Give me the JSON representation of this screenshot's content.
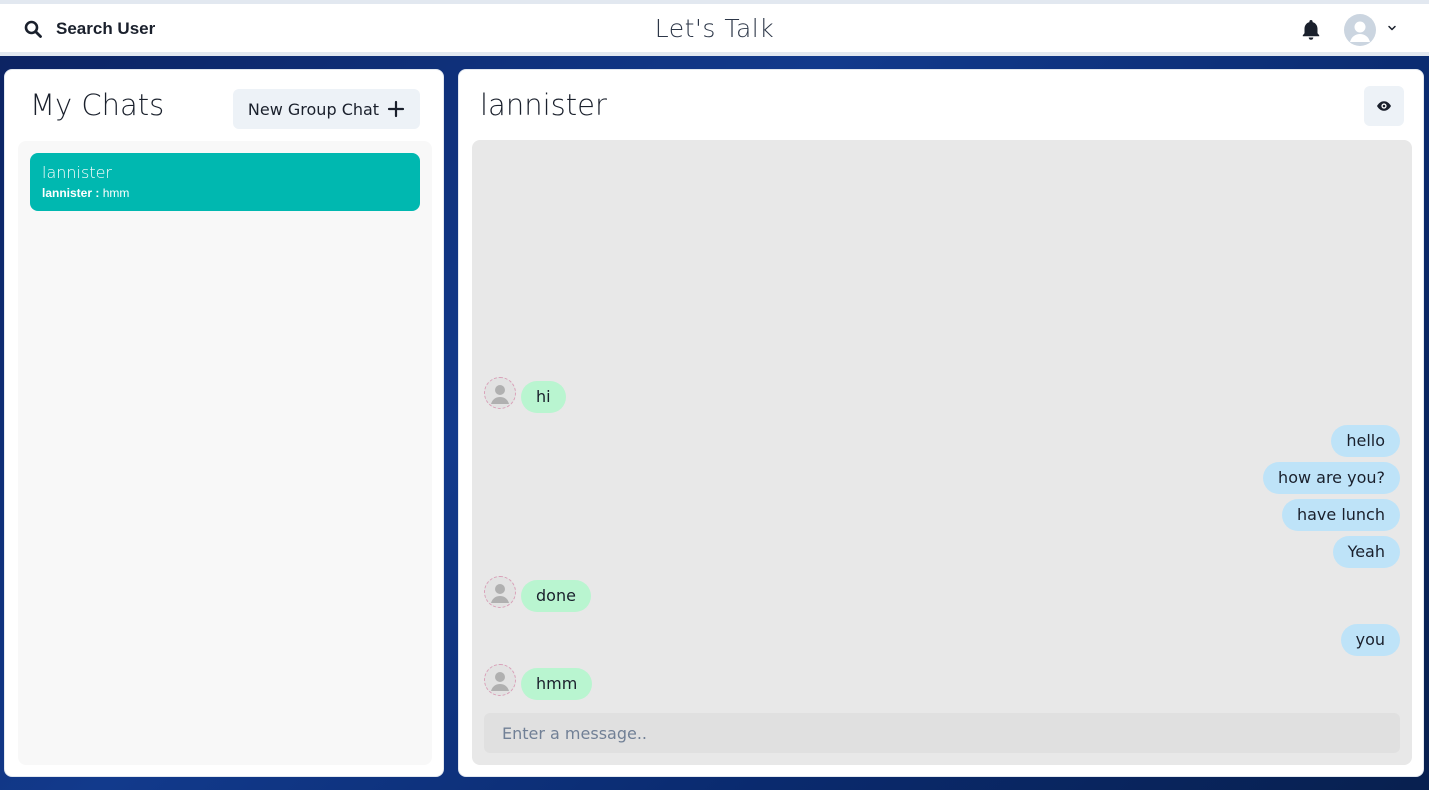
{
  "header": {
    "search_label": "Search User",
    "app_title": "Let's Talk",
    "icons": {
      "search": "search-icon",
      "notifications": "bell-icon",
      "avatar": "user-avatar-icon",
      "menu": "chevron-down-icon"
    }
  },
  "sidebar": {
    "title": "My Chats",
    "new_group_label": "New Group Chat",
    "chats": [
      {
        "name": "lannister",
        "latest_sender": "lannister :",
        "latest_text": "hmm",
        "selected": true
      }
    ]
  },
  "chat": {
    "title": "lannister",
    "view_profile_icon": "eye-icon",
    "messages": [
      {
        "text": "hi",
        "direction": "received",
        "show_avatar": true
      },
      {
        "text": "hello",
        "direction": "sent"
      },
      {
        "text": "how are you?",
        "direction": "sent"
      },
      {
        "text": "have lunch",
        "direction": "sent"
      },
      {
        "text": "Yeah",
        "direction": "sent"
      },
      {
        "text": "done",
        "direction": "received",
        "show_avatar": true
      },
      {
        "text": "you",
        "direction": "sent"
      },
      {
        "text": "hmm",
        "direction": "received",
        "show_avatar": true
      }
    ],
    "input_placeholder": "Enter a message.."
  },
  "colors": {
    "selected_chat": "#00b8b0",
    "received_bubble": "#b9f5d0",
    "sent_bubble": "#bee3f8",
    "background": "#0b2260"
  }
}
